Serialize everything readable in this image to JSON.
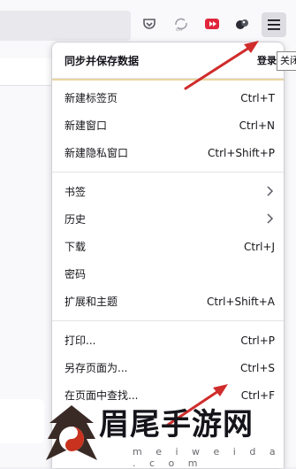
{
  "toolbar": {
    "icons": [
      "pocket-icon",
      "sync-off-icon",
      "extension-red-icon",
      "extension-dark-icon"
    ],
    "menu_icon": "hamburger-menu-icon"
  },
  "tooltip": {
    "text": "关闭"
  },
  "panel": {
    "header": {
      "title": "同步并保存数据",
      "login": "登录"
    },
    "groups": [
      [
        {
          "label": "新建标签页",
          "key": "Ctrl+T"
        },
        {
          "label": "新建窗口",
          "key": "Ctrl+N"
        },
        {
          "label": "新建隐私窗口",
          "key": "Ctrl+Shift+P"
        }
      ],
      [
        {
          "label": "书签",
          "key": "",
          "submenu": true
        },
        {
          "label": "历史",
          "key": "",
          "submenu": true
        },
        {
          "label": "下载",
          "key": "Ctrl+J"
        },
        {
          "label": "密码",
          "key": ""
        },
        {
          "label": "扩展和主题",
          "key": "Ctrl+Shift+A"
        }
      ],
      [
        {
          "label": "打印...",
          "key": "Ctrl+P"
        },
        {
          "label": "另存页面为...",
          "key": "Ctrl+S"
        },
        {
          "label": "在页面中查找...",
          "key": "Ctrl+F"
        }
      ]
    ]
  },
  "watermark": {
    "title": "眉尾手游网",
    "subtitle": "m e i w e i d a . c o m"
  },
  "colors": {
    "arrow": "#d02c2c",
    "accent": "#e9d6a0"
  }
}
